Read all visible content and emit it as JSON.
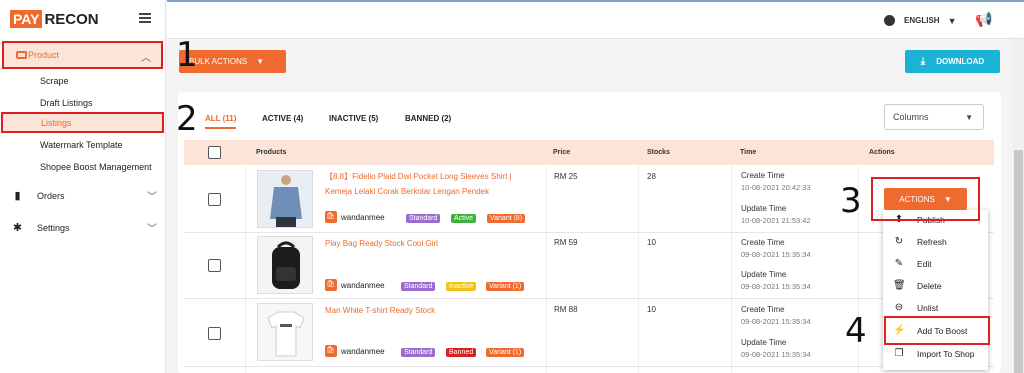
{
  "logo": {
    "part1": "PAY",
    "part2": "RECON"
  },
  "sidebar": {
    "product": "Product",
    "sub": [
      "Scrape",
      "Draft Listings",
      "Listings",
      "Watermark Template",
      "Shopee Boost Management"
    ],
    "orders": "Orders",
    "settings": "Settings"
  },
  "topbar": {
    "language": "ENGLISH"
  },
  "toolbar": {
    "bulk": "BULK ACTIONS",
    "download": "DOWNLOAD"
  },
  "tabs": [
    "ALL (11)",
    "ACTIVE (4)",
    "INACTIVE (5)",
    "BANNED (2)"
  ],
  "columns_select": "Columns",
  "table": {
    "headers": [
      "Products",
      "Price",
      "Stocks",
      "Time",
      "Actions"
    ],
    "rows": [
      {
        "name1": "【8.8】Fidelio Plaid Dwi Pocket Long Sleeves Shirt |",
        "name2": "Kemeja Lelaki Corak Berkolar Lengan Pendek",
        "shop": "wandanmee",
        "b1": "Standard",
        "b2": "Active",
        "b3": "Variant (8)",
        "price": "RM 25",
        "stock": "28",
        "create_label": "Create Time",
        "create": "10-08-2021 20:42:33",
        "update_label": "Update Time",
        "update": "10-08-2021 21:53:42"
      },
      {
        "name1": "Play Bag Ready Stock Cool Girl",
        "name2": "",
        "shop": "wandanmee",
        "b1": "Standard",
        "b2": "Inactive",
        "b3": "Variant (1)",
        "price": "RM 59",
        "stock": "10",
        "create_label": "Create Time",
        "create": "09-08-2021 15:35:34",
        "update_label": "Update Time",
        "update": "09-08-2021 15:35:34"
      },
      {
        "name1": "Man White T-shirt Ready Stock",
        "name2": "",
        "shop": "wandanmee",
        "b1": "Standard",
        "b2": "Banned",
        "b3": "Variant (1)",
        "price": "RM 88",
        "stock": "10",
        "create_label": "Create Time",
        "create": "09-08-2021 15:35:34",
        "update_label": "Update Time",
        "update": "09-08-2021 15:35:34"
      }
    ]
  },
  "actions": {
    "button": "ACTIONS",
    "menu": [
      "Publish",
      "Refresh",
      "Edit",
      "Delete",
      "Unlist",
      "Add To Boost",
      "Import To Shop"
    ]
  },
  "steps": [
    "1",
    "2",
    "3",
    "4"
  ],
  "colors": {
    "brand": "#ee6a2e",
    "download": "#1ab3d6",
    "highlight": "#e02020",
    "standard": "#9b6dd0",
    "active": "#3cb43c",
    "inactive": "#f0c419",
    "banned": "#d92121"
  }
}
